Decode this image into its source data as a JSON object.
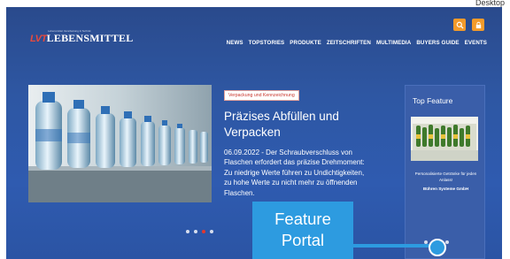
{
  "window": {
    "label": "Desktop"
  },
  "header": {
    "logo_mark": "LVT",
    "logo_text": "LEBENSMITTEL",
    "logo_tag": "Lebensmittel Verarbeitung & Technik"
  },
  "nav": {
    "items": [
      "NEWS",
      "TOPSTORIES",
      "PRODUKTE",
      "ZEITSCHRIFTEN",
      "MULTIMEDIA",
      "BUYERS GUIDE",
      "EVENTS"
    ]
  },
  "article": {
    "category": "Verpackung und Kennzeichnung",
    "headline": "Präzises Abfüllen und Verpacken",
    "date": "06.09.2022 -",
    "teaser": "Der Schraubverschluss von Flaschen erfordert das präzise Drehmoment: Zu niedrige Werte führen zu Undichtigkeiten, zu hohe Werte zu nicht mehr zu öffnenden Flaschen."
  },
  "slider": {
    "count": 4,
    "active_index": 2
  },
  "feature": {
    "title": "Top Feature",
    "caption": "Personalisierte Getränke für jeden Anlass!",
    "company": "Bühren Systeme GmbH",
    "slider": {
      "count": 4,
      "active_index": 1
    }
  },
  "callout": {
    "line1": "Feature",
    "line2": "Portal"
  },
  "colors": {
    "brand_blue": "#2e57a3",
    "accent_orange": "#f39a2a",
    "accent_red": "#e2372e",
    "callout_blue": "#2d9be0"
  }
}
